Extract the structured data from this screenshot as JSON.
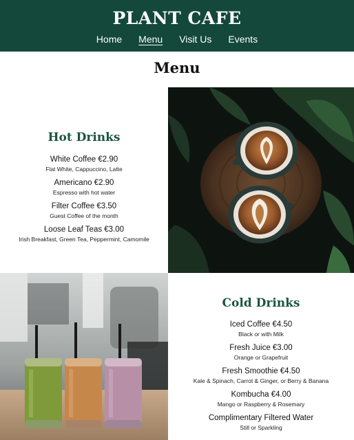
{
  "header": {
    "brand": "PLANT CAFE",
    "nav": [
      "Home",
      "Menu",
      "Visit Us",
      "Events"
    ],
    "active_nav": "Menu",
    "background_color": "#13483a"
  },
  "page_title": "Menu",
  "hot_drinks": {
    "heading": "Hot Drinks",
    "items": [
      {
        "name": "White Coffee €2.90",
        "desc": "Flat White, Cappuccino, Latte"
      },
      {
        "name": "Americano €2.90",
        "desc": "Espresso with hot water"
      },
      {
        "name": "Filter Coffee €3.50",
        "desc": "Guest Coffee of the month"
      },
      {
        "name": "Loose Leaf Teas €3.00",
        "desc": "Irish Breakfast, Green Tea, Peppermint, Camomile"
      }
    ]
  },
  "cold_drinks": {
    "heading": "Cold Drinks",
    "items": [
      {
        "name": "Iced Coffee €4.50",
        "desc": "Black or with Milk"
      },
      {
        "name": "Fresh Juice €3.00",
        "desc": "Orange or Grapefruit"
      },
      {
        "name": "Fresh Smoothie €4.50",
        "desc": "Kale & Spinach, Carrot & Ginger, or Berry & Banana"
      },
      {
        "name": "Kombucha €4.00",
        "desc": "Mango or Raspberry & Rosemary"
      },
      {
        "name": "Complimentary Filtered Water",
        "desc": "Still or Sparkling"
      }
    ]
  },
  "images": {
    "coffee_photo": "two-latte-art-cups-on-wooden-table-icon",
    "smoothie_photo": "three-smoothie-jars-with-straws-icon"
  },
  "colors": {
    "heading_green": "#1b5542",
    "header_green": "#13483a"
  }
}
